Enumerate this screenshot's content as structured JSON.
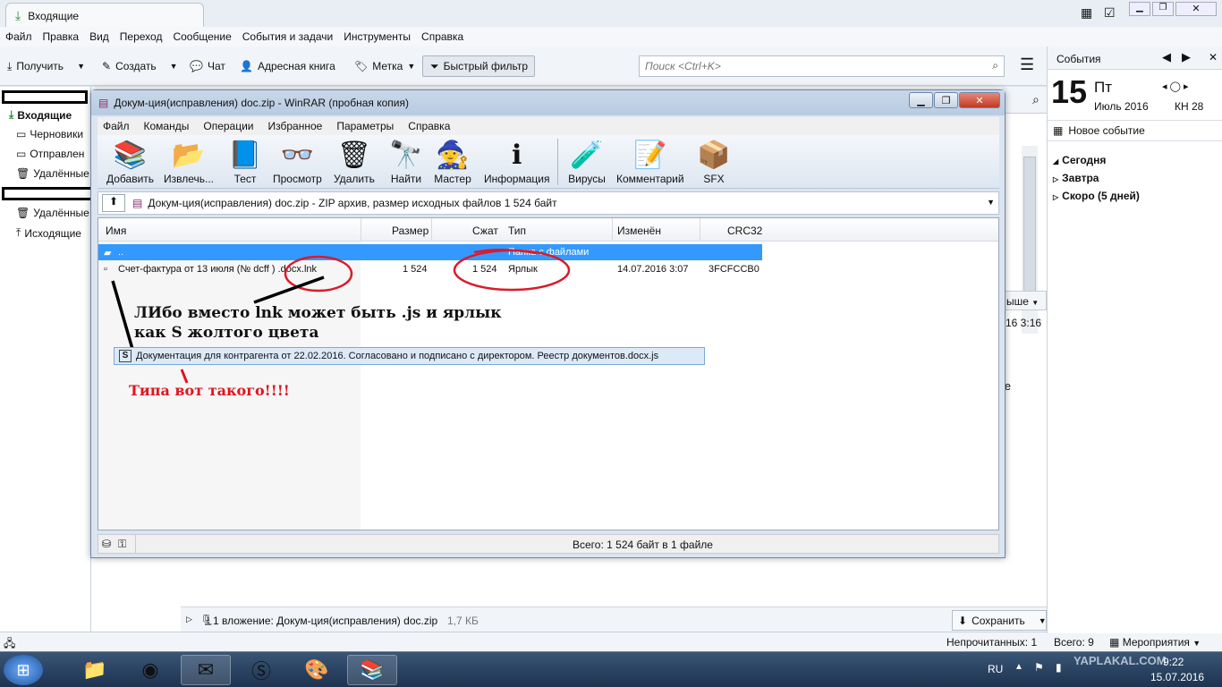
{
  "thunderbird": {
    "tab_title": "Входящие",
    "menu": [
      "Файл",
      "Правка",
      "Вид",
      "Переход",
      "Сообщение",
      "События и задачи",
      "Инструменты",
      "Справка"
    ],
    "toolbar": {
      "get": "Получить",
      "write": "Создать",
      "chat": "Чат",
      "addressbook": "Адресная книга",
      "tag": "Метка",
      "quickfilter": "Быстрый фильтр"
    },
    "search_placeholder": "Поиск <Ctrl+K>",
    "folders": [
      "Входящие",
      "Черновики",
      "Отправлен",
      "Удалённые",
      "Удалённые",
      "Исходящие"
    ],
    "partial_texts": {
      "sort_fragment": "ыше",
      "date_fragment": "16 3:16",
      "text_fragment": "те"
    },
    "attachment": {
      "text": "1 вложение: Докум-ция(исправления) doc.zip",
      "size": "1,7 КБ",
      "save": "Сохранить"
    },
    "status": {
      "unread": "Непрочитанных: 1",
      "total": "Всего: 9",
      "events": "Мероприятия"
    }
  },
  "today": {
    "title": "События",
    "day": "15",
    "weekday": "Пт",
    "month_year": "Июль 2016",
    "week": "КН 28",
    "new_event": "Новое событие",
    "groups": [
      "Сегодня",
      "Завтра",
      "Скоро (5 дней)"
    ]
  },
  "winrar": {
    "title": "Докум-ция(исправления) doc.zip - WinRAR (пробная копия)",
    "menu": [
      "Файл",
      "Команды",
      "Операции",
      "Избранное",
      "Параметры",
      "Справка"
    ],
    "tools": [
      "Добавить",
      "Извлечь...",
      "Тест",
      "Просмотр",
      "Удалить",
      "Найти",
      "Мастер",
      "Информация",
      "Вирусы",
      "Комментарий",
      "SFX"
    ],
    "path": "Докум-ция(исправления) doc.zip - ZIP архив, размер исходных файлов 1 524 байт",
    "columns": [
      "Имя",
      "Размер",
      "Сжат",
      "Тип",
      "Изменён",
      "CRC32"
    ],
    "rows": [
      {
        "name": "..",
        "size": "",
        "packed": "",
        "type": "Папка с файлами",
        "modified": "",
        "crc": ""
      },
      {
        "name": "Счет-фактура от 13 июля (№ dcff ) .docx.lnk",
        "size": "1 524",
        "packed": "1 524",
        "type": "Ярлык",
        "modified": "14.07.2016 3:07",
        "crc": "3FCFCCB0"
      }
    ],
    "status": "Всего: 1 524 байт в 1 файле"
  },
  "annotations": {
    "line1": "ЛИбо вместо lnk может быть .js и ярлык",
    "line2": "как S жолтого цвета",
    "example_file": "Документация для контрагента от 22.02.2016. Согласовано и подписано с директором. Реестр документов.docx.js",
    "red_note": "Типа вот такого!!!!"
  },
  "taskbar": {
    "lang": "RU",
    "time": "9:22",
    "date": "15.07.2016",
    "watermark": "YAPLAKAL.COM"
  },
  "colors": {
    "selection": "#3399ff",
    "annotation_red": "#e0141e",
    "circle_red": "#d91c2a"
  }
}
